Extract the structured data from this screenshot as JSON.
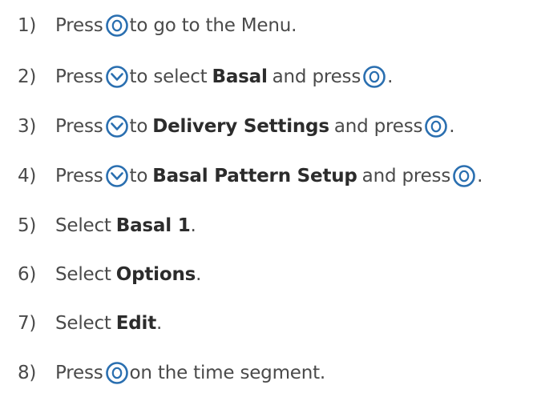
{
  "colors": {
    "text": "#4a4a4a",
    "bold_text": "#2c2c2c",
    "button_outline": "#2a6fb0"
  },
  "icons": {
    "select_button": "circle-o-button-icon",
    "down_button": "chevron-down-button-icon"
  },
  "steps": [
    {
      "number": "1)",
      "parts": [
        "Press",
        "to go to the Menu."
      ]
    },
    {
      "number": "2)",
      "parts": [
        "Press",
        "to select",
        "Basal",
        "and press",
        "."
      ]
    },
    {
      "number": "3)",
      "parts": [
        "Press",
        "to",
        "Delivery Settings",
        "and press",
        "."
      ]
    },
    {
      "number": "4)",
      "parts": [
        "Press",
        "to",
        "Basal Pattern Setup",
        "and press",
        "."
      ]
    },
    {
      "number": "5)",
      "parts": [
        "Select",
        "Basal 1",
        "."
      ]
    },
    {
      "number": "6)",
      "parts": [
        "Select",
        "Options",
        "."
      ]
    },
    {
      "number": "7)",
      "parts": [
        "Select",
        "Edit",
        "."
      ]
    },
    {
      "number": "8)",
      "parts": [
        "Press",
        "on the time segment."
      ]
    }
  ]
}
